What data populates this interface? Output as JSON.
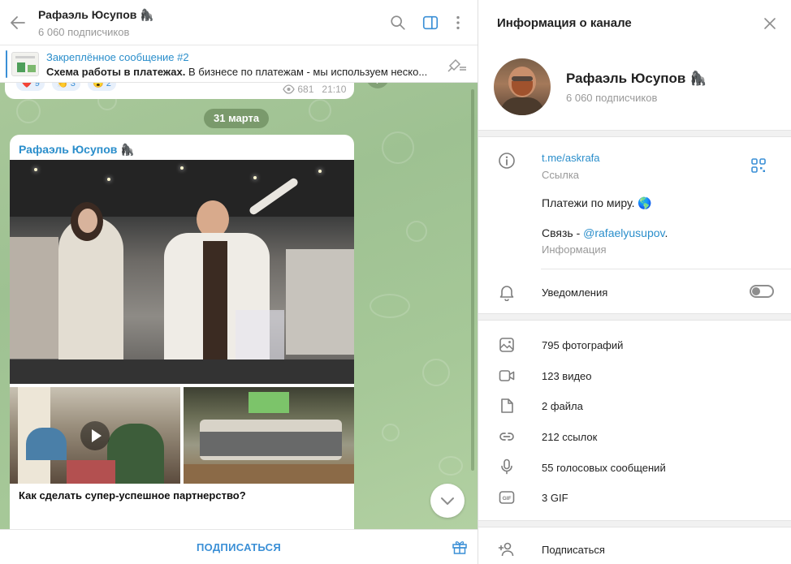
{
  "chat": {
    "title": "Рафаэль Юсупов 🦍",
    "subscribers": "6 060 подписчиков",
    "pinned": {
      "title": "Закреплённое сообщение #2",
      "text_bold": "Схема работы в платежах.",
      "text_rest": " В бизнесе по платежам - мы используем неско..."
    },
    "prev_message": {
      "reactions": [
        {
          "emoji": "❤️",
          "count": "9"
        },
        {
          "emoji": "👏",
          "count": "3"
        },
        {
          "emoji": "😮",
          "count": "2"
        }
      ],
      "views": "681",
      "time": "21:10"
    },
    "date_separator": "31 марта",
    "post": {
      "author": "Рафаэль Юсупов 🦍",
      "caption": "Как сделать супер-успешное партнерство?"
    },
    "footer": {
      "subscribe_label": "ПОДПИСАТЬСЯ"
    }
  },
  "info": {
    "title": "Информация о канале",
    "channel_name": "Рафаэль Юсупов 🦍",
    "subscribers": "6 060 подписчиков",
    "link": "t.me/askrafa",
    "link_label": "Ссылка",
    "description": "Платежи по миру. 🌎",
    "contact_prefix": "Связь - ",
    "contact_handle": "@rafaelyusupov",
    "contact_suffix": ".",
    "contact_label": "Информация",
    "notifications_label": "Уведомления",
    "notifications_on": false,
    "media": [
      {
        "icon": "photo-icon",
        "label": "795 фотографий"
      },
      {
        "icon": "video-icon",
        "label": "123 видео"
      },
      {
        "icon": "file-icon",
        "label": "2 файла"
      },
      {
        "icon": "link-icon",
        "label": "212 ссылок"
      },
      {
        "icon": "microphone-icon",
        "label": "55 голосовых сообщений"
      },
      {
        "icon": "gif-icon",
        "label": "3 GIF"
      }
    ],
    "subscribe_label": "Подписаться"
  },
  "colors": {
    "accent": "#3a8fd6",
    "link": "#2a8ecb",
    "chat_background": "#a9c89a"
  }
}
